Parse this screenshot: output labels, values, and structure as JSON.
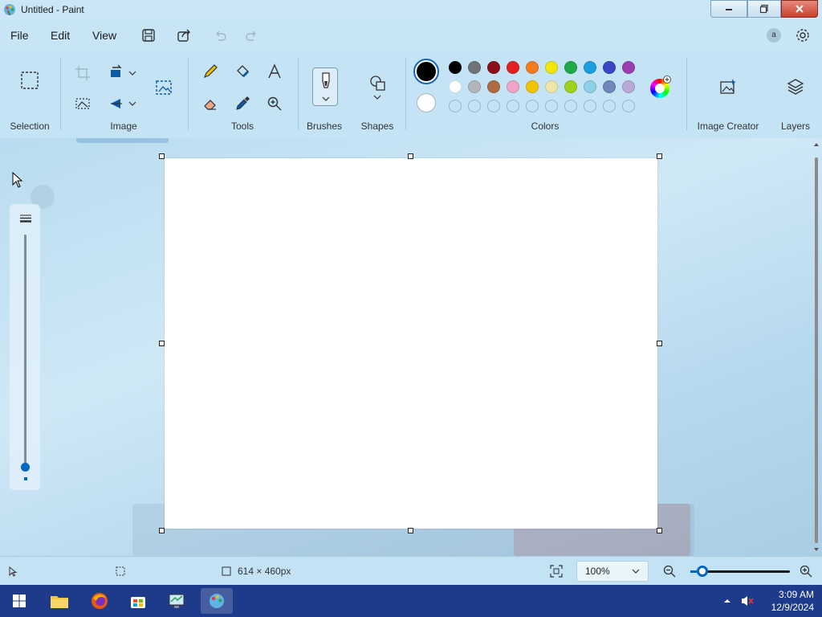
{
  "window": {
    "title": "Untitled - Paint"
  },
  "menu": {
    "file": "File",
    "edit": "Edit",
    "view": "View",
    "account_initial": "a"
  },
  "ribbon": {
    "groups": {
      "selection": "Selection",
      "image": "Image",
      "tools": "Tools",
      "brushes": "Brushes",
      "shapes": "Shapes",
      "colors": "Colors",
      "image_creator": "Image Creator",
      "layers": "Layers"
    },
    "colors": {
      "primary": "#000000",
      "secondary": "#ffffff",
      "row1": [
        "#000000",
        "#6f7478",
        "#8b0f19",
        "#e32020",
        "#f57c1f",
        "#f2e60d",
        "#1fa84a",
        "#1a9ede",
        "#3a46c4",
        "#9b3fb0"
      ],
      "row2": [
        "#ffffff",
        "#b2b6b9",
        "#b06b44",
        "#f2a4c6",
        "#f5c400",
        "#eee5a8",
        "#9ed21c",
        "#8ed2e7",
        "#6e87b8",
        "#b9a9d8"
      ]
    }
  },
  "status": {
    "canvas_size": "614 × 460px",
    "zoom": "100%"
  },
  "taskbar": {
    "time": "3:09 AM",
    "date": "12/9/2024"
  }
}
